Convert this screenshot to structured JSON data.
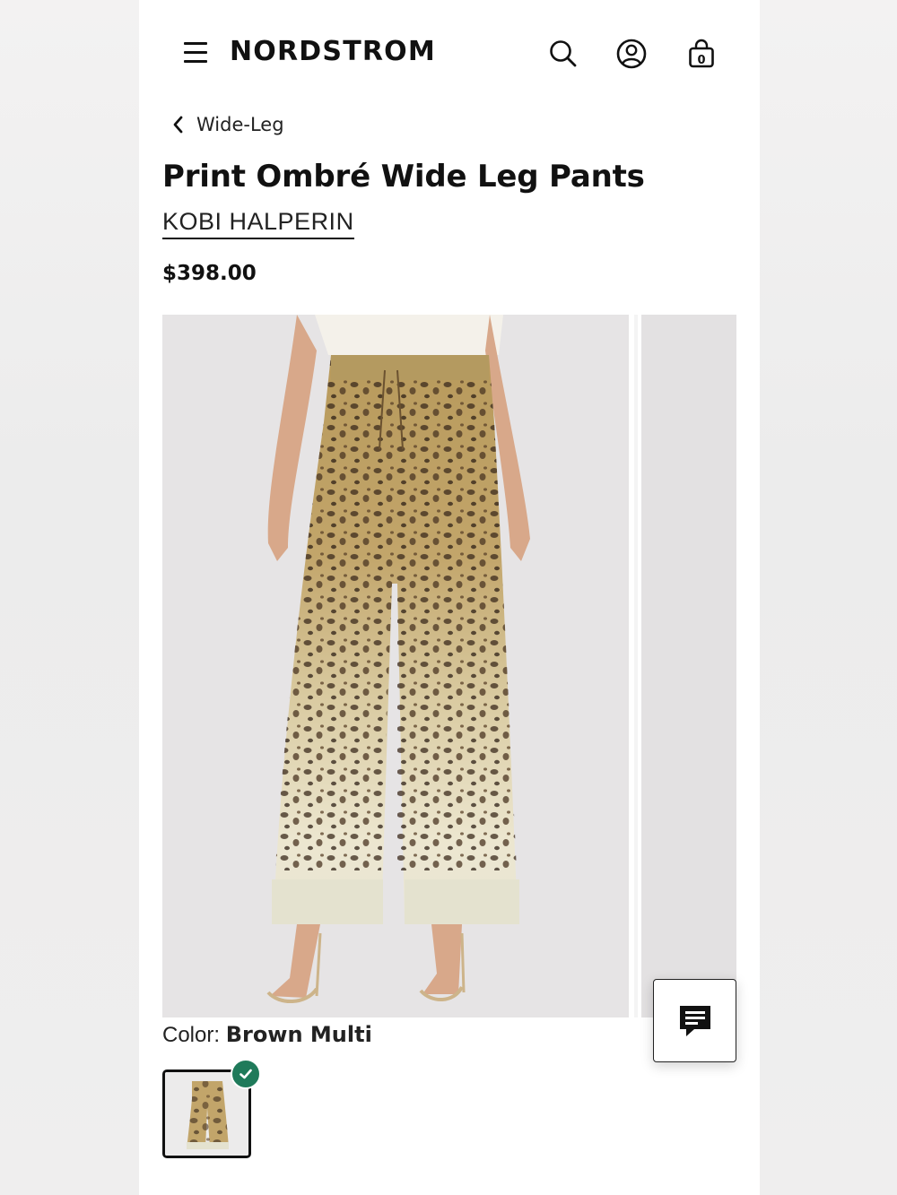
{
  "header": {
    "logo": "NORDSTROM",
    "bag_count": "0",
    "icons": [
      "menu-icon",
      "search-icon",
      "account-icon",
      "shopping-bag-icon"
    ]
  },
  "breadcrumb": {
    "label": "Wide-Leg",
    "icon": "chevron-left-icon"
  },
  "product": {
    "title": "Print Ombré Wide Leg Pants",
    "brand": "KOBI HALPERIN",
    "price": "$398.00",
    "color_label": "Color: ",
    "color_value": "Brown Multi"
  },
  "gallery": {
    "images": [
      "leopard-print-wide-leg-pants-front",
      "next-image-partial"
    ],
    "swatches": [
      {
        "name": "Brown Multi",
        "selected": true
      }
    ]
  },
  "chat": {
    "icon": "chat-icon"
  },
  "colors": {
    "selected_badge": "#1f7a5a",
    "text": "#111111"
  }
}
